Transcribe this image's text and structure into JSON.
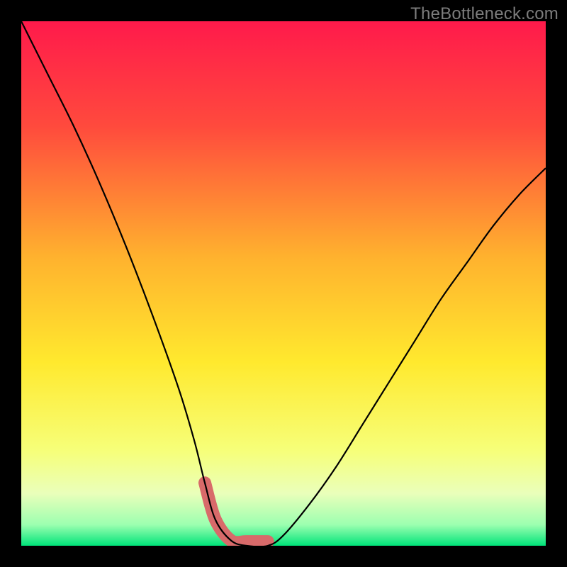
{
  "watermark": "TheBottleneck.com",
  "chart_data": {
    "type": "line",
    "title": "",
    "xlabel": "",
    "ylabel": "",
    "xlim": [
      0,
      100
    ],
    "ylim": [
      0,
      100
    ],
    "series": [
      {
        "name": "curve",
        "x": [
          0,
          5,
          10,
          15,
          20,
          25,
          30,
          33,
          35,
          37,
          40,
          43,
          47,
          50,
          55,
          60,
          65,
          70,
          75,
          80,
          85,
          90,
          95,
          100
        ],
        "y": [
          100,
          90,
          80,
          69,
          57,
          44,
          30,
          20,
          12,
          5,
          1,
          0,
          0,
          2,
          8,
          15,
          23,
          31,
          39,
          47,
          54,
          61,
          67,
          72
        ]
      }
    ],
    "highlight": {
      "x0": 35,
      "x1": 47
    },
    "gradient_stops": [
      {
        "offset": 0,
        "color": "#ff1a4b"
      },
      {
        "offset": 20,
        "color": "#ff4a3d"
      },
      {
        "offset": 45,
        "color": "#ffb22e"
      },
      {
        "offset": 65,
        "color": "#ffe92e"
      },
      {
        "offset": 82,
        "color": "#f6ff7a"
      },
      {
        "offset": 90,
        "color": "#eaffba"
      },
      {
        "offset": 96,
        "color": "#9cffb0"
      },
      {
        "offset": 100,
        "color": "#00e47a"
      }
    ]
  }
}
